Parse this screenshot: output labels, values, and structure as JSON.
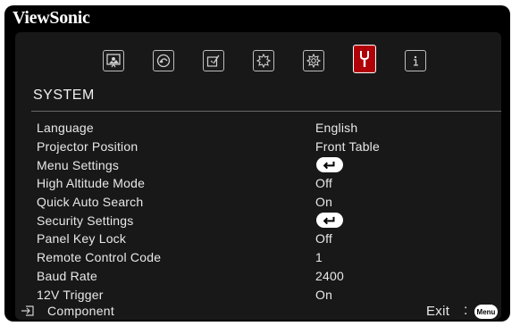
{
  "brand": "ViewSonic",
  "tabs": [
    {
      "icon": "picture-icon",
      "active": false
    },
    {
      "icon": "audio-icon",
      "active": false
    },
    {
      "icon": "display-icon",
      "active": false
    },
    {
      "icon": "advanced-icon",
      "active": false
    },
    {
      "icon": "settings-icon",
      "active": false
    },
    {
      "icon": "system-wrench-icon",
      "active": true
    },
    {
      "icon": "info-icon",
      "active": false
    }
  ],
  "section_title": "SYSTEM",
  "rows": [
    {
      "label": "Language",
      "value": "English"
    },
    {
      "label": "Projector Position",
      "value": "Front Table"
    },
    {
      "label": "Menu Settings",
      "value": "",
      "enter": true
    },
    {
      "label": "High Altitude Mode",
      "value": "Off"
    },
    {
      "label": "Quick Auto Search",
      "value": "On"
    },
    {
      "label": "Security Settings",
      "value": "",
      "enter": true
    },
    {
      "label": "Panel Key Lock",
      "value": "Off"
    },
    {
      "label": "Remote Control Code",
      "value": "1"
    },
    {
      "label": "Baud Rate",
      "value": "2400"
    },
    {
      "label": "12V Trigger",
      "value": "On"
    }
  ],
  "footer": {
    "source_icon": "input-source-icon",
    "source_label": "Component",
    "exit_label": "Exit",
    "colon": ":",
    "menu_button": "Menu"
  },
  "colors": {
    "background": "#000000",
    "panel": "#181818",
    "active_tab": "#b00008",
    "text": "#e8e8e8"
  }
}
